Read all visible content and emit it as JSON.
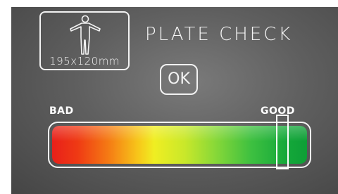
{
  "header": {
    "title": "PLATE CHECK",
    "plate_dimensions": "195x120mm",
    "plate_icon": "human-figure-icon"
  },
  "actions": {
    "ok_label": "OK"
  },
  "meter": {
    "label_bad": "BAD",
    "label_good": "GOOD",
    "value": 0.9,
    "colors": {
      "bad": "#e8201a",
      "mid": "#f0ee22",
      "good": "#0e9e36",
      "indicator": "#ffffff"
    }
  }
}
